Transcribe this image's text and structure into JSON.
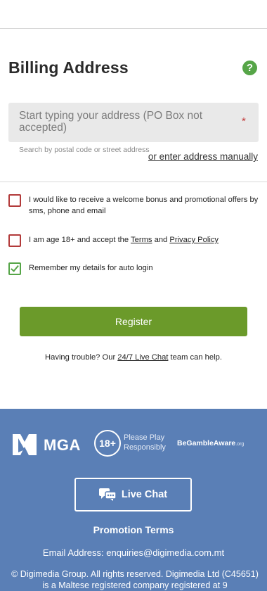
{
  "billing": {
    "title": "Billing Address",
    "help_icon": "?",
    "address_placeholder": "Start typing your address (PO Box not accepted)",
    "required_mark": "*",
    "hint": "Search by postal code or street address",
    "manual_link": "or enter address manually"
  },
  "consents": [
    {
      "text": "I would like to receive a welcome bonus and promotional offers by sms, phone and email",
      "checked": false
    },
    {
      "text_before": "I am age 18+ and accept the ",
      "terms": "Terms",
      "text_and": " and ",
      "privacy": "Privacy Policy",
      "checked": false
    },
    {
      "text": "Remember my details for auto login",
      "checked": true
    }
  ],
  "register": {
    "label": "Register"
  },
  "trouble": {
    "before": "Having trouble? Our ",
    "link": "24/7 Live Chat",
    "after": " team can help."
  },
  "footer": {
    "mga": "MGA",
    "age": "18+",
    "play_responsibly_1": "Please Play",
    "play_responsibly_2": "Responsibly",
    "gamble_aware": "BeGambleAware",
    "gamble_aware_org": ".org",
    "live_chat": "Live Chat",
    "promotion_terms": "Promotion Terms",
    "email": "Email Address: enquiries@digimedia.com.mt",
    "copyright": "© Digimedia Group. All rights reserved. Digimedia Ltd (C45651) is a Maltese registered company registered at 9"
  },
  "colors": {
    "accent_green": "#6b9a2a",
    "footer_blue": "#5a7fb6",
    "error_red": "#b23a3a",
    "check_green": "#56a548"
  }
}
